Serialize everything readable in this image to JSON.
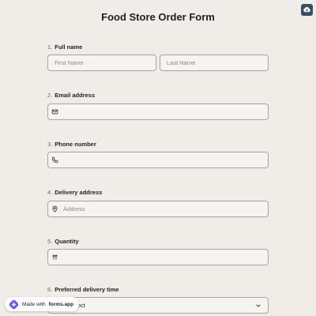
{
  "form": {
    "title": "Food Store Order Form"
  },
  "questions": [
    {
      "number": "1.",
      "label": "Full name",
      "first_placeholder": "First Name",
      "last_placeholder": "Last Name"
    },
    {
      "number": "2.",
      "label": "Email address",
      "placeholder": ""
    },
    {
      "number": "3.",
      "label": "Phone number",
      "placeholder": ""
    },
    {
      "number": "4.",
      "label": "Delivery address",
      "placeholder": "Address"
    },
    {
      "number": "5.",
      "label": "Quantity",
      "placeholder": ""
    },
    {
      "number": "6.",
      "label": "Preferred delivery time",
      "select_value": "Select"
    }
  ],
  "badge": {
    "prefix": "Made with",
    "brand": "forms.app"
  },
  "icons": {
    "cloud": "cloud-upload-icon",
    "email": "mail-icon",
    "phone": "phone-icon",
    "address": "map-pin-icon",
    "quantity": "sort-arrows-icon",
    "select": "chevron-down-icon",
    "brand": "forms-app-logo-icon"
  },
  "colors": {
    "background": "#f0ede8",
    "field_background": "#f5f4f1",
    "field_border": "#a7a5a1",
    "cloud_button": "#3b4d66",
    "brand_purple": "#6c5ce7"
  }
}
